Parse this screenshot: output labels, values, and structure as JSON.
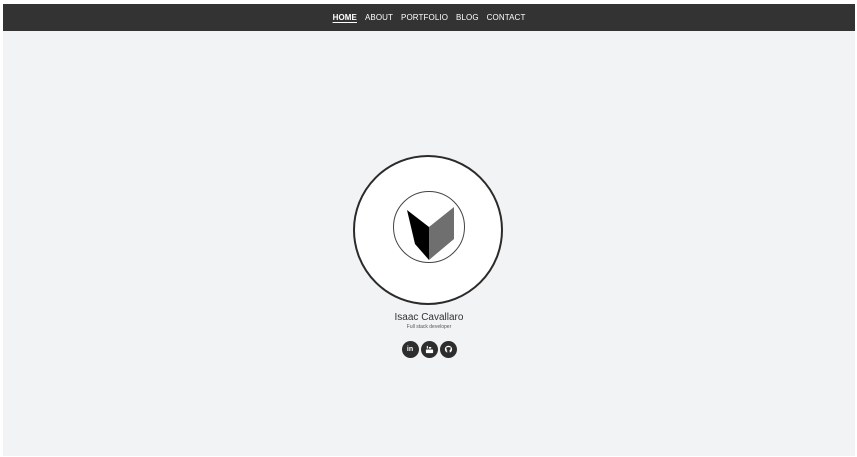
{
  "nav": {
    "items": [
      {
        "label": "HOME",
        "active": true
      },
      {
        "label": "ABOUT",
        "active": false
      },
      {
        "label": "PORTFOLIO",
        "active": false
      },
      {
        "label": "BLOG",
        "active": false
      },
      {
        "label": "CONTACT",
        "active": false
      }
    ]
  },
  "profile": {
    "name": "Isaac Cavallaro",
    "subtitle": "Full stack developer",
    "logo_icon": "shield-v-logo-icon"
  },
  "social": {
    "icons": [
      "linkedin-icon",
      "youtube-icon",
      "github-icon"
    ],
    "linkedin_text": "in"
  },
  "colors": {
    "navbar": "#333333",
    "background": "#f2f3f5",
    "social_bg": "#2d2d2d"
  }
}
